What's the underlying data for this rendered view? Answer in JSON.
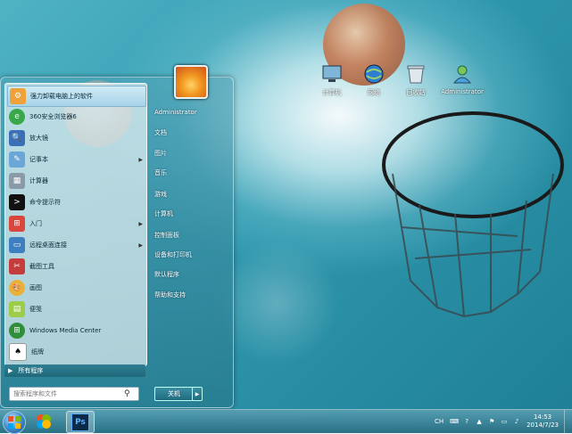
{
  "desktop_icons": [
    {
      "label": "计算机",
      "icon": "computer-icon"
    },
    {
      "label": "网络",
      "icon": "network-icon"
    },
    {
      "label": "回收站",
      "icon": "recycle-bin-icon"
    },
    {
      "label": "Administrator",
      "icon": "user-folder-icon"
    }
  ],
  "start_menu": {
    "programs": [
      {
        "label": "强力卸载电脑上的软件",
        "icon": "uninstaller-icon",
        "has_arrow": false,
        "highlight": true
      },
      {
        "label": "360安全浏览器6",
        "icon": "browser-360-icon",
        "has_arrow": false
      },
      {
        "label": "放大镜",
        "icon": "magnifier-icon",
        "has_arrow": false
      },
      {
        "label": "记事本",
        "icon": "notepad-icon",
        "has_arrow": true
      },
      {
        "label": "计算器",
        "icon": "calculator-icon",
        "has_arrow": false
      },
      {
        "label": "命令提示符",
        "icon": "command-prompt-icon",
        "has_arrow": false
      },
      {
        "label": "入门",
        "icon": "getting-started-icon",
        "has_arrow": true
      },
      {
        "label": "远程桌面连接",
        "icon": "remote-desktop-icon",
        "has_arrow": true
      },
      {
        "label": "截图工具",
        "icon": "snipping-tool-icon",
        "has_arrow": false
      },
      {
        "label": "画图",
        "icon": "paint-icon",
        "has_arrow": false
      },
      {
        "label": "便笺",
        "icon": "sticky-notes-icon",
        "has_arrow": false
      },
      {
        "label": "Windows Media Center",
        "icon": "media-center-icon",
        "has_arrow": false
      },
      {
        "label": "纸牌",
        "icon": "solitaire-icon",
        "has_arrow": false
      }
    ],
    "all_programs": "所有程序",
    "search_placeholder": "搜索程序和文件",
    "right_items": [
      "Administrator",
      "文档",
      "图片",
      "音乐",
      "游戏",
      "计算机",
      "控制面板",
      "设备和打印机",
      "默认程序",
      "帮助和支持"
    ],
    "shutdown": "关机"
  },
  "taskbar": {
    "time": "14:53",
    "date": "2014/7/23",
    "ch_label": "CH",
    "pinned": [
      "start-orb",
      "photos-app-icon",
      "photoshop-icon"
    ],
    "ps_label": "Ps"
  },
  "colors": {
    "accent": "#2f98ae",
    "taskbar": "#2b7f96"
  }
}
